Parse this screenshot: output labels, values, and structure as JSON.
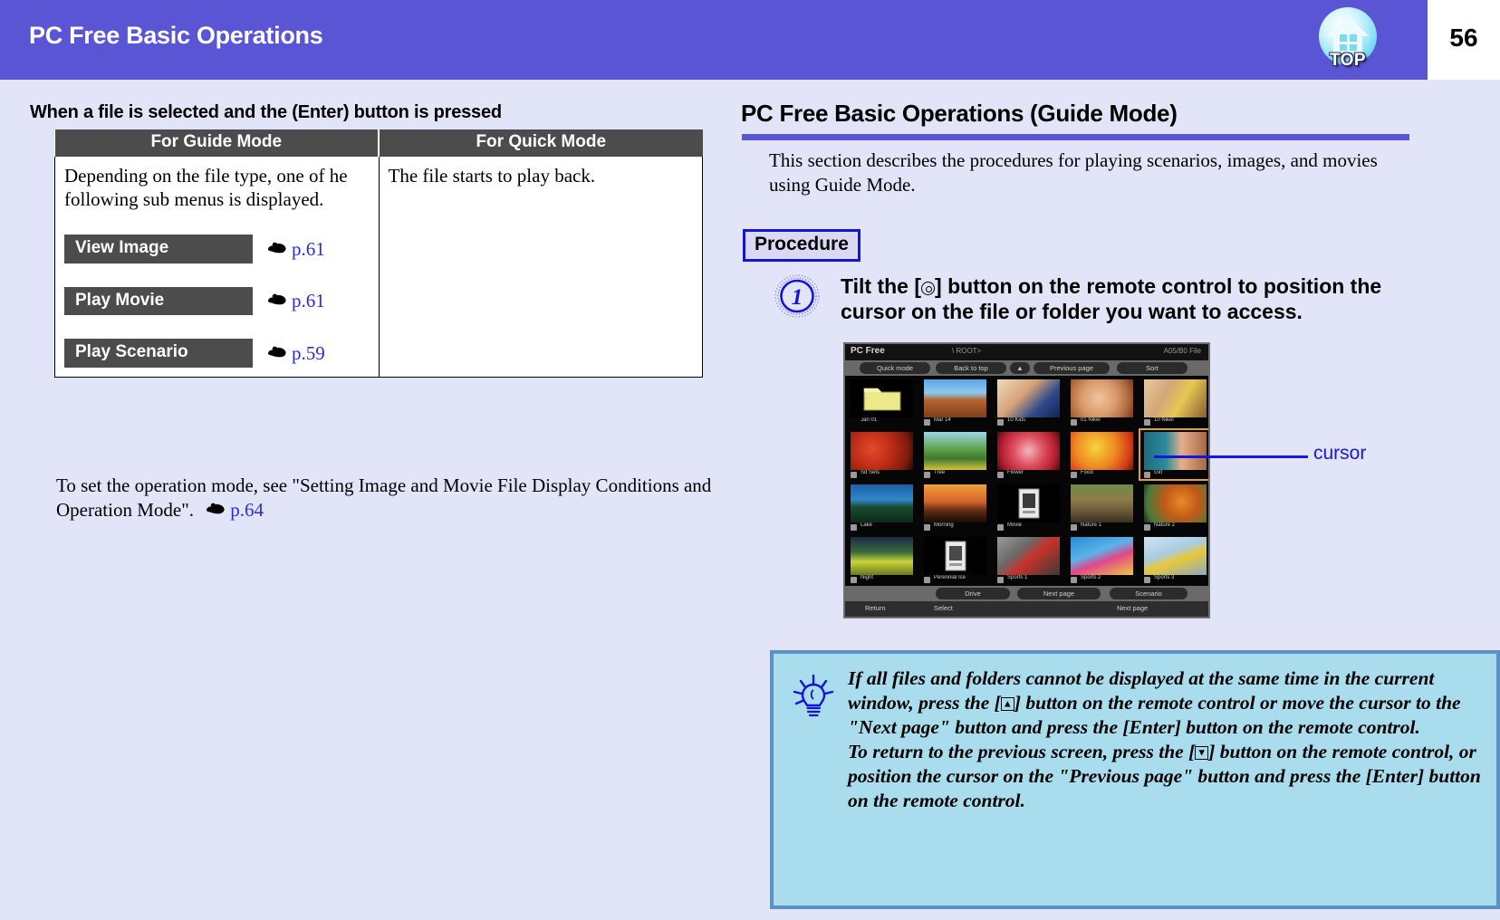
{
  "header": {
    "title": "PC Free Basic Operations",
    "page_number": "56",
    "top_icon_label": "TOP"
  },
  "left": {
    "subheading": "When a file is selected and the (Enter) button is pressed",
    "table": {
      "columns": [
        "For Guide Mode",
        "For Quick Mode"
      ],
      "guide_intro": "Depending on the file type, one of he following sub menus is displayed.",
      "quick_text": "The file starts to play back.",
      "menu_items": [
        {
          "label": "View Image",
          "page_ref": "p.61"
        },
        {
          "label": "Play Movie",
          "page_ref": "p.61"
        },
        {
          "label": "Play Scenario",
          "page_ref": "p.59"
        }
      ]
    },
    "note_text": "To set the operation mode, see \"Setting Image and Movie File Display Conditions and Operation Mode\".",
    "note_page_ref": "p.64"
  },
  "right": {
    "section_title": "PC Free Basic Operations (Guide Mode)",
    "description": "This section describes the procedures for playing scenarios, images, and movies using Guide Mode.",
    "procedure_label": "Procedure",
    "step": {
      "number": "1",
      "text_before": "Tilt the [",
      "text_after": "] button on the remote control to position the cursor on the file or folder you want to access."
    },
    "callout_label": "cursor",
    "screenshot": {
      "app_name": "PC Free",
      "path": "\\ ROOT>",
      "status_right": "A05/B0 File",
      "menu_buttons": [
        "Quick mode",
        "Back to top",
        "▲",
        "Previous page",
        "Sort"
      ],
      "bottom_buttons": [
        "Drive",
        "Next page",
        "Scenario"
      ],
      "status_buttons": [
        "Return",
        "Select",
        "Next page"
      ],
      "cells": [
        {
          "label": "Jan 01",
          "type": "folder"
        },
        {
          "label": "Mar 14",
          "type": "image"
        },
        {
          "label": "10 Kids",
          "type": "image"
        },
        {
          "label": "01 Nikel",
          "type": "image"
        },
        {
          "label": "10 Nikel",
          "type": "image"
        },
        {
          "label": "Sd Sets",
          "type": "image"
        },
        {
          "label": "Tree",
          "type": "image"
        },
        {
          "label": "Flower",
          "type": "image"
        },
        {
          "label": "Food",
          "type": "image"
        },
        {
          "label": "Girl",
          "type": "image"
        },
        {
          "label": "Lake",
          "type": "image"
        },
        {
          "label": "Morning",
          "type": "image"
        },
        {
          "label": "Movie",
          "type": "movie"
        },
        {
          "label": "Nature 1",
          "type": "image"
        },
        {
          "label": "Nature 2",
          "type": "image"
        },
        {
          "label": "Night",
          "type": "image"
        },
        {
          "label": "Perennial Ice",
          "type": "movie"
        },
        {
          "label": "Sports 1",
          "type": "image"
        },
        {
          "label": "Sports 2",
          "type": "image"
        },
        {
          "label": "Sports 3",
          "type": "image"
        }
      ],
      "selected_index": 9
    },
    "tip": {
      "line1_a": "If all files and folders cannot be displayed at the same time in the current window, press the [",
      "line1_b": "] button on the remote control or move the cursor to the \"Next page\" button and press the [Enter] button on the remote control.",
      "line2_a": "To return to the previous screen, press the [",
      "line2_b": "] button on the remote control, or position the cursor on the \"Previous page\" button and press the [Enter] button on the remote control."
    }
  },
  "colors": {
    "header_purple": "#5a55d4",
    "page_background": "#e2e4f8",
    "table_header_gray": "#4c4c4c",
    "link_blue": "#2a2ae0",
    "tip_background": "#a9dced",
    "tip_border": "#5b91c4",
    "cursor_highlight": "#e7a13a"
  }
}
